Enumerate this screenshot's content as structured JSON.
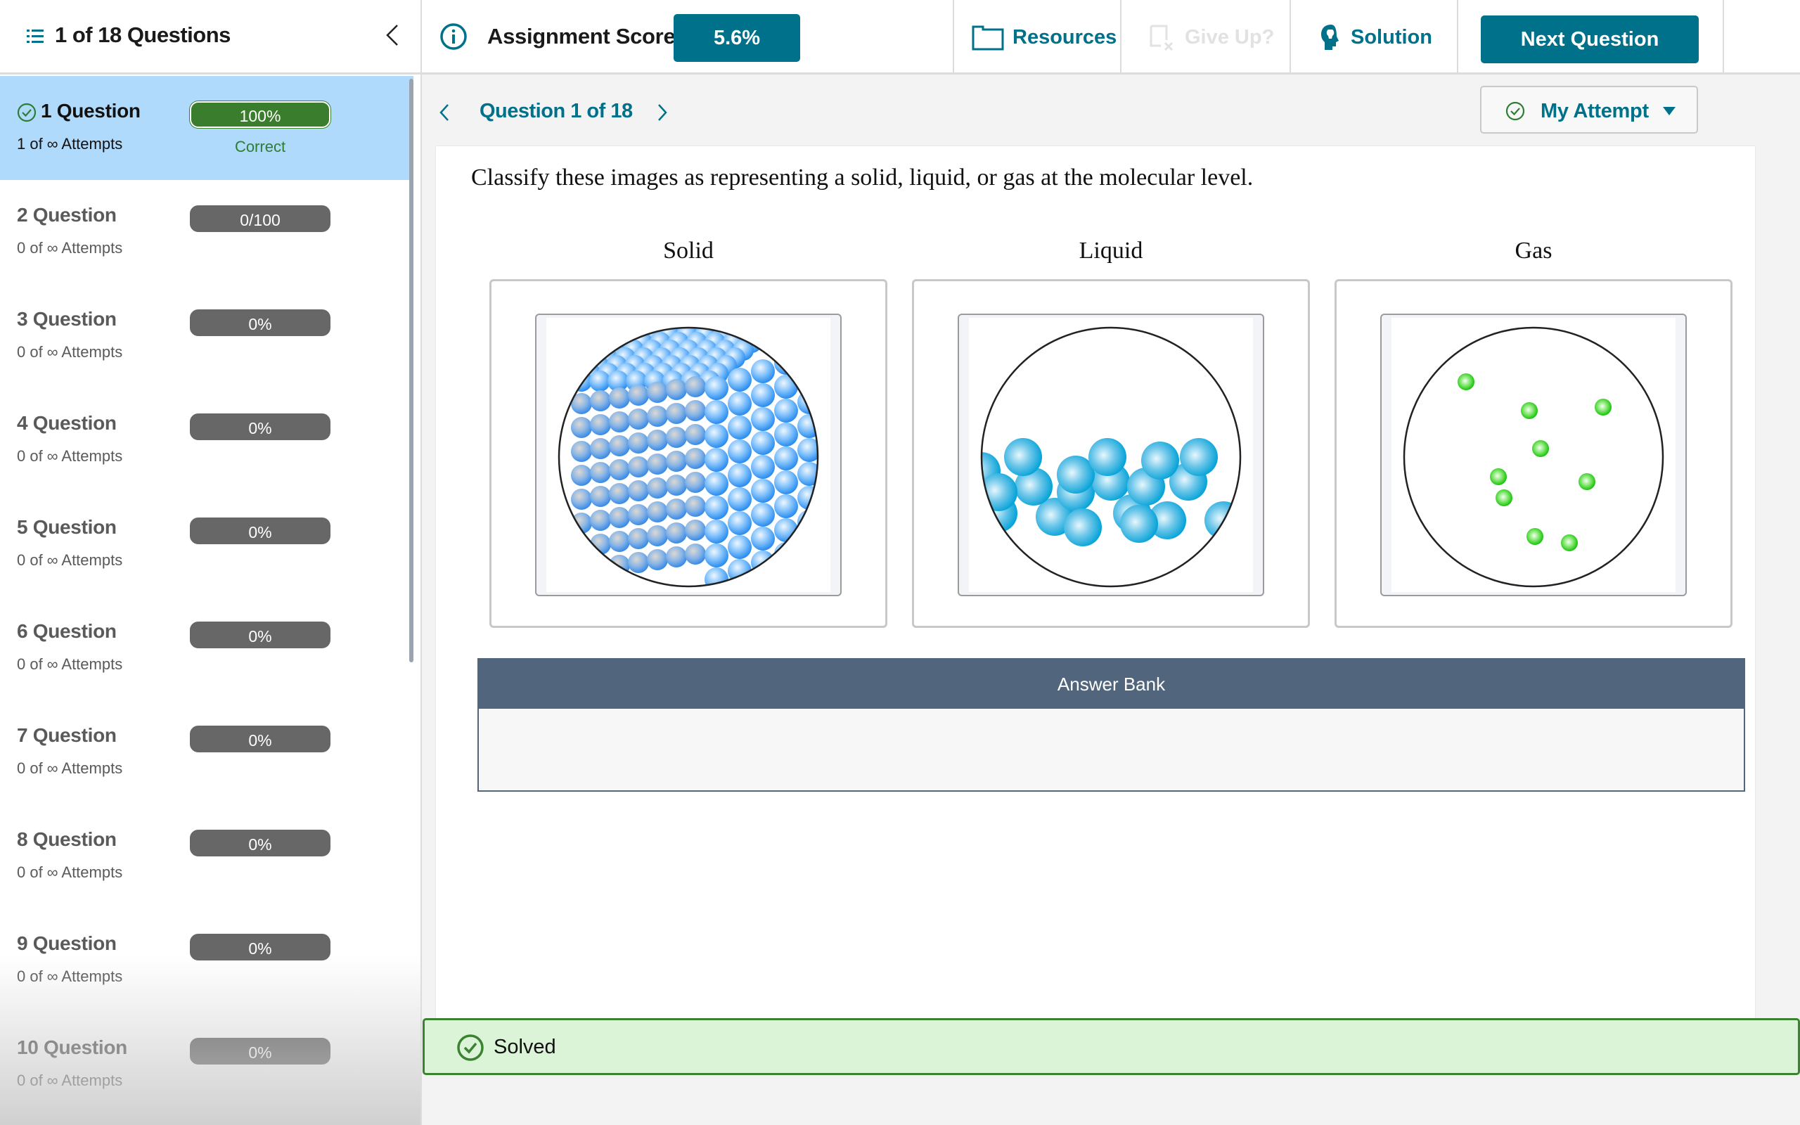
{
  "sidebar": {
    "title": "1 of 18 Questions",
    "list_icon": "list-icon",
    "collapse_icon": "chevron-left-icon",
    "questions": [
      {
        "label": "1 Question",
        "attempts": "1 of ∞ Attempts",
        "score": "100%",
        "status": "Correct",
        "active": true,
        "solved": true
      },
      {
        "label": "2 Question",
        "attempts": "0 of ∞ Attempts",
        "score": "0/100",
        "status": "",
        "active": false,
        "solved": false
      },
      {
        "label": "3 Question",
        "attempts": "0 of ∞ Attempts",
        "score": "0%",
        "status": "",
        "active": false,
        "solved": false
      },
      {
        "label": "4 Question",
        "attempts": "0 of ∞ Attempts",
        "score": "0%",
        "status": "",
        "active": false,
        "solved": false
      },
      {
        "label": "5 Question",
        "attempts": "0 of ∞ Attempts",
        "score": "0%",
        "status": "",
        "active": false,
        "solved": false
      },
      {
        "label": "6 Question",
        "attempts": "0 of ∞ Attempts",
        "score": "0%",
        "status": "",
        "active": false,
        "solved": false
      },
      {
        "label": "7 Question",
        "attempts": "0 of ∞ Attempts",
        "score": "0%",
        "status": "",
        "active": false,
        "solved": false
      },
      {
        "label": "8 Question",
        "attempts": "0 of ∞ Attempts",
        "score": "0%",
        "status": "",
        "active": false,
        "solved": false
      },
      {
        "label": "9 Question",
        "attempts": "0 of ∞ Attempts",
        "score": "0%",
        "status": "",
        "active": false,
        "solved": false
      },
      {
        "label": "10 Question",
        "attempts": "0 of ∞ Attempts",
        "score": "0%",
        "status": "",
        "active": false,
        "solved": false
      }
    ]
  },
  "topbar": {
    "score_label": "Assignment Score:",
    "score_value": "5.6%",
    "resources_label": "Resources",
    "give_up_label": "Give Up?",
    "solution_label": "Solution",
    "next_label": "Next Question"
  },
  "subnav": {
    "counter": "Question 1 of 18",
    "attempt_label": "My Attempt"
  },
  "question": {
    "prompt": "Classify these images as representing a solid, liquid, or gas at the molecular level.",
    "columns": [
      "Solid",
      "Liquid",
      "Gas"
    ],
    "images": [
      "solid-lattice-image",
      "liquid-particles-image",
      "gas-particles-image"
    ]
  },
  "answer_bank": {
    "title": "Answer Bank",
    "items": []
  },
  "status_banner": {
    "label": "Solved"
  },
  "colors": {
    "brand": "#00718a",
    "correct": "#3a7d2c",
    "solved_bg": "#dbf4d7",
    "active_item": "#b0dafc",
    "answer_bank_header": "#51657c"
  }
}
